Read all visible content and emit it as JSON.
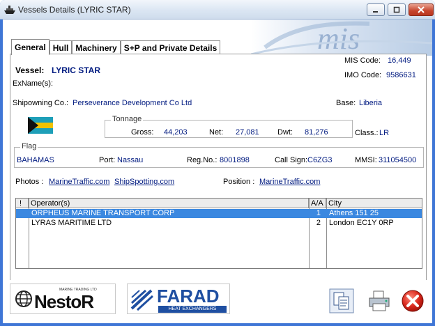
{
  "window": {
    "title": "Vessels Details  (LYRIC STAR)"
  },
  "tabs": [
    {
      "label": "General",
      "active": true
    },
    {
      "label": "Hull"
    },
    {
      "label": "Machinery"
    },
    {
      "label": "S+P and Private Details"
    }
  ],
  "general": {
    "vessel_label": "Vessel:",
    "vessel_name": "LYRIC STAR",
    "exnames_label": "ExName(s):",
    "mis_code_label": "MIS Code:",
    "mis_code": "16,449",
    "imo_code_label": "IMO Code:",
    "imo_code": "9586631",
    "shipowning_label": "Shipowning Co.:",
    "shipowning_value": "Perseverance Development Co Ltd",
    "base_label": "Base:",
    "base_value": "Liberia",
    "tonnage": {
      "legend": "Tonnage",
      "gross_label": "Gross:",
      "gross": "44,203",
      "net_label": "Net:",
      "net": "27,081",
      "dwt_label": "Dwt:",
      "dwt": "81,276"
    },
    "class_label": "Class.:",
    "class_value": "LR",
    "flag": {
      "legend": "Flag",
      "country": "BAHAMAS",
      "port_label": "Port:",
      "port": "Nassau",
      "regno_label": "Reg.No.:",
      "regno": "8001898",
      "callsign_label": "Call Sign:",
      "callsign": "C6ZG3",
      "mmsi_label": "MMSI:",
      "mmsi": "311054500"
    },
    "photos_label": "Photos :",
    "photos_link1": "MarineTraffic.com",
    "photos_link2": "ShipSpotting.com",
    "position_label": "Position :",
    "position_link": "MarineTraffic.com"
  },
  "operators_table": {
    "columns": [
      "!",
      "Operator(s)",
      "A/A",
      "City"
    ],
    "rows": [
      {
        "operator": "ORPHEUS MARINE TRANSPORT CORP",
        "aa": "1",
        "city": "Athens 151 25",
        "selected": true
      },
      {
        "operator": "LYRAS MARITIME LTD",
        "aa": "2",
        "city": "London EC1Y 0RP",
        "selected": false
      }
    ]
  },
  "footer": {
    "nestor_small": "MARINE TRADING LTD",
    "nestor_text": "NestoR",
    "farad_text": "FARAD",
    "farad_sub": "HEAT  EXCHANGERS"
  },
  "colors": {
    "accent": "#001a80",
    "selection": "#3b88e0",
    "title_frame": "#3f76d6"
  }
}
